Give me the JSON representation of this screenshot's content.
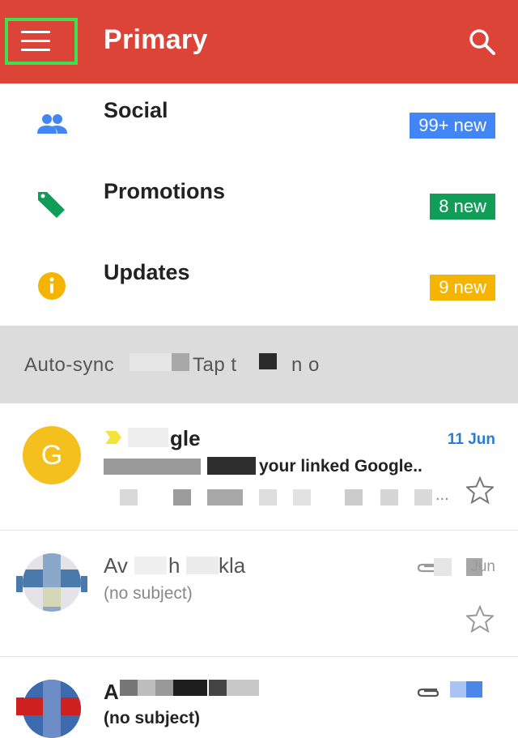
{
  "header": {
    "title": "Primary",
    "menu_icon": "hamburger-menu-icon",
    "search_icon": "search-icon",
    "color": "#db4437"
  },
  "categories": [
    {
      "label": "Social",
      "badge": "99+ new",
      "icon": "people-icon",
      "badge_color": "#4285f4",
      "icon_color": "#4285f4"
    },
    {
      "label": "Promotions",
      "badge": "8 new",
      "icon": "tag-icon",
      "badge_color": "#0f9d58",
      "icon_color": "#0f9d58"
    },
    {
      "label": "Updates",
      "badge": "9 new",
      "icon": "info-icon",
      "badge_color": "#f4b400",
      "icon_color": "#f4b400"
    }
  ],
  "sync_banner": {
    "visible_fragments": [
      "Auto-sync",
      "Tap t",
      "n o"
    ]
  },
  "emails": [
    {
      "avatar_letter": "G",
      "sender": "gle",
      "date": "11 Jun",
      "snippet": "your linked Google..",
      "ellipsis": "...",
      "unread": true
    },
    {
      "sender_prefix": "Av",
      "sender_middle": "h",
      "sender_suffix": "kla",
      "subject": "(no subject)",
      "date": "Jun"
    },
    {
      "sender_prefix": "A",
      "subject": "(no subject)"
    }
  ]
}
